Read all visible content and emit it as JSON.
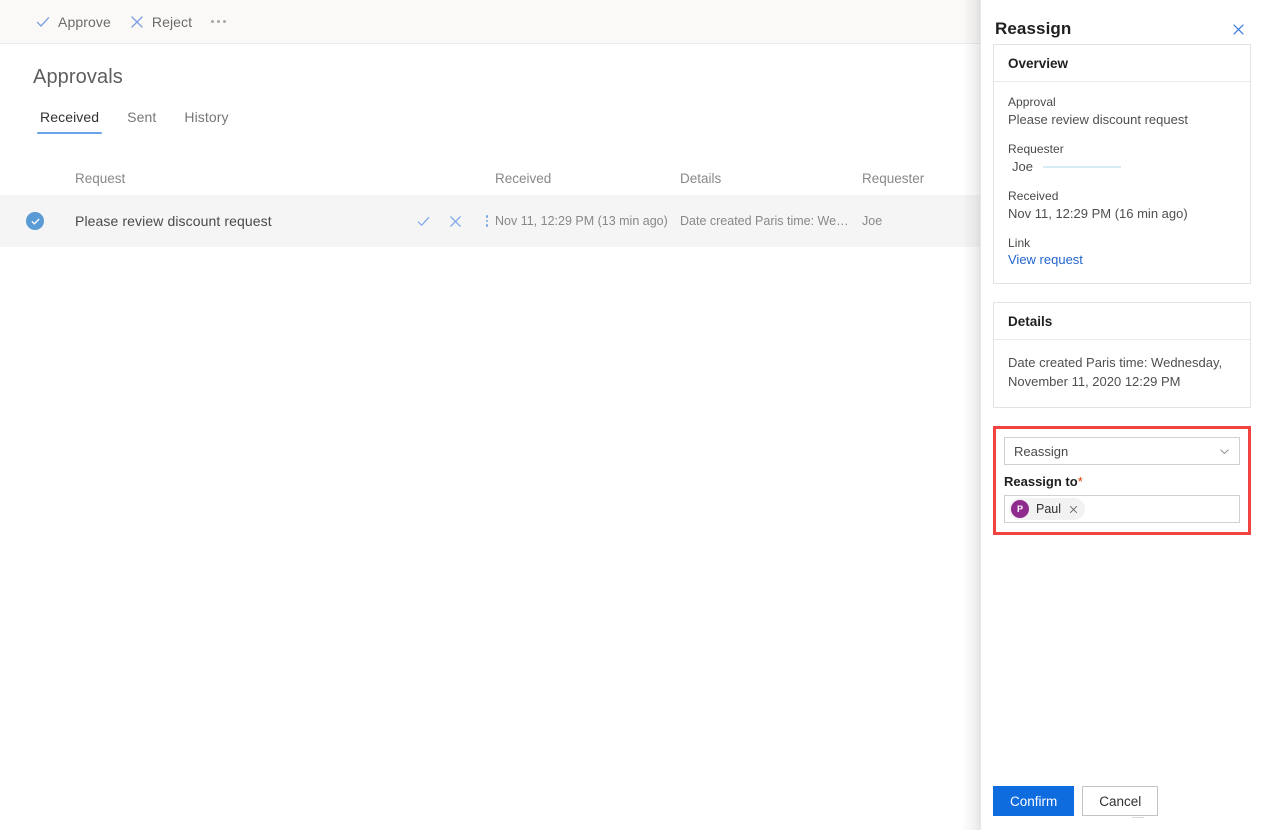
{
  "command_bar": {
    "approve_label": "Approve",
    "reject_label": "Reject",
    "approve_icon": "checkmark-icon",
    "reject_icon": "close-x-icon",
    "overflow_icon": "ellipsis-horizontal-icon"
  },
  "page": {
    "title": "Approvals"
  },
  "tabs": [
    {
      "label": "Received",
      "active": true
    },
    {
      "label": "Sent",
      "active": false
    },
    {
      "label": "History",
      "active": false
    }
  ],
  "table": {
    "columns": {
      "request": "Request",
      "received": "Received",
      "details": "Details",
      "requester": "Requester"
    },
    "rows": [
      {
        "selected": true,
        "request": "Please review discount request",
        "received": "Nov 11, 12:29 PM (13 min ago)",
        "details": "Date created Paris time: Wednesday,...",
        "requester": "Joe",
        "actions": {
          "approve_icon": "checkmark-icon",
          "reject_icon": "close-x-icon",
          "more_icon": "ellipsis-vertical-icon"
        }
      }
    ]
  },
  "panel": {
    "title": "Reassign",
    "close_icon": "close-x-icon",
    "overview": {
      "heading": "Overview",
      "approval_label": "Approval",
      "approval_value": "Please review discount request",
      "requester_label": "Requester",
      "requester_value": "Joe",
      "received_label": "Received",
      "received_value": "Nov 11, 12:29 PM (16 min ago)",
      "link_label": "Link",
      "link_text": "View request"
    },
    "details": {
      "heading": "Details",
      "text": "Date created Paris time: Wednesday, November 11, 2020 12:29 PM"
    },
    "reassign": {
      "action_selected": "Reassign",
      "dropdown_icon": "chevron-down-icon",
      "reassign_to_label": "Reassign to",
      "required_marker": "*",
      "person": {
        "initial": "P",
        "name": "Paul",
        "remove_icon": "close-x-icon"
      },
      "highlight_color": "#f1433f"
    },
    "footer": {
      "confirm_label": "Confirm",
      "cancel_label": "Cancel"
    }
  },
  "colors": {
    "accent_blue": "#0f6cde",
    "tab_underline": "#6ba2e8",
    "avatar_purple": "#8f2a8f",
    "highlight_red": "#f1433f",
    "link_blue": "#2266cc"
  }
}
